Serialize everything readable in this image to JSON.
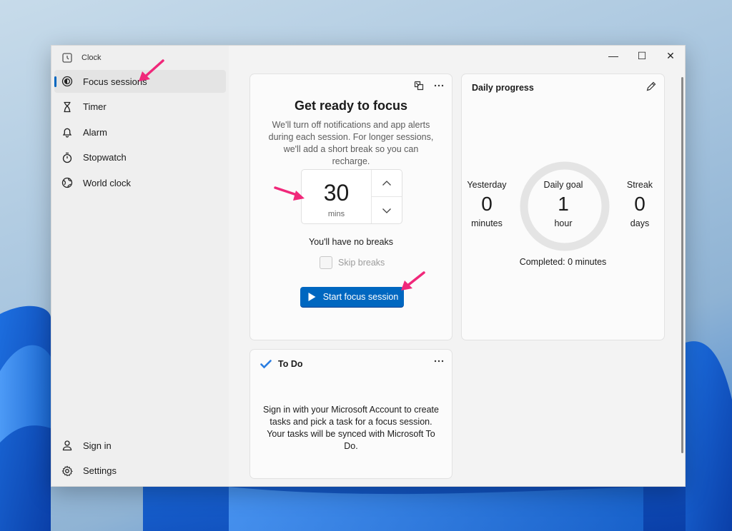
{
  "app": {
    "title": "Clock"
  },
  "sidebar": {
    "items": [
      {
        "label": "Focus sessions",
        "icon": "focus-icon",
        "active": true
      },
      {
        "label": "Timer",
        "icon": "hourglass-icon"
      },
      {
        "label": "Alarm",
        "icon": "bell-icon"
      },
      {
        "label": "Stopwatch",
        "icon": "stopwatch-icon"
      },
      {
        "label": "World clock",
        "icon": "globe-icon"
      }
    ],
    "bottom": [
      {
        "label": "Sign in",
        "icon": "person-icon"
      },
      {
        "label": "Settings",
        "icon": "gear-icon"
      }
    ]
  },
  "window_controls": {
    "minimize": "—",
    "maximize": "☐",
    "close": "✕"
  },
  "focus": {
    "title": "Get ready to focus",
    "description": "We'll turn off notifications and app alerts during each session. For longer sessions, we'll add a short break so you can recharge.",
    "minutes": "30",
    "unit": "mins",
    "breaks_text": "You'll have no breaks",
    "skip_breaks_label": "Skip breaks",
    "start_label": "Start focus session"
  },
  "daily_progress": {
    "title": "Daily progress",
    "yesterday": {
      "label": "Yesterday",
      "value": "0",
      "unit": "minutes"
    },
    "goal": {
      "label": "Daily goal",
      "value": "1",
      "unit": "hour"
    },
    "streak": {
      "label": "Streak",
      "value": "0",
      "unit": "days"
    },
    "completed": "Completed: 0 minutes",
    "progress_fraction": 0
  },
  "todo": {
    "title": "To Do",
    "description": "Sign in with your Microsoft Account to create tasks and pick a task for a focus session. Your tasks will be synced with Microsoft To Do."
  },
  "colors": {
    "accent": "#0067c0",
    "annotation_arrow": "#f0287a"
  }
}
